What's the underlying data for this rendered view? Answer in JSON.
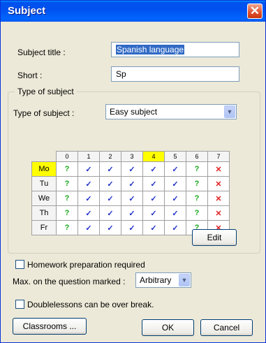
{
  "window": {
    "title": "Subject",
    "close_glyph": "✕"
  },
  "form": {
    "subject_title_label": "Subject title :",
    "subject_title_value": "Spanish language",
    "short_label": "Short :",
    "short_value": "Sp"
  },
  "group": {
    "legend": "Type of subject",
    "type_label": "Type of subject :",
    "type_value": "Easy subject",
    "periods": [
      "0",
      "1",
      "2",
      "3",
      "4",
      "5",
      "6",
      "7"
    ],
    "highlight_period": "4",
    "days": [
      {
        "name": "Mo",
        "cells": [
          "?",
          "✓",
          "✓",
          "✓",
          "✓",
          "✓",
          "?",
          "✕"
        ]
      },
      {
        "name": "Tu",
        "cells": [
          "?",
          "✓",
          "✓",
          "✓",
          "✓",
          "✓",
          "?",
          "✕"
        ]
      },
      {
        "name": "We",
        "cells": [
          "?",
          "✓",
          "✓",
          "✓",
          "✓",
          "✓",
          "?",
          "✕"
        ]
      },
      {
        "name": "Th",
        "cells": [
          "?",
          "✓",
          "✓",
          "✓",
          "✓",
          "✓",
          "?",
          "✕"
        ]
      },
      {
        "name": "Fr",
        "cells": [
          "?",
          "✓",
          "✓",
          "✓",
          "✓",
          "✓",
          "?",
          "✕"
        ]
      }
    ],
    "highlight_day": "Mo",
    "edit_button": "Edit"
  },
  "options": {
    "homework_label": "Homework preparation required",
    "homework_checked": false,
    "max_label": "Max. on the question marked :",
    "max_value": "Arbitrary",
    "double_label": "Doublelessons can be over break.",
    "double_checked": false
  },
  "buttons": {
    "classrooms": "Classrooms ...",
    "ok": "OK",
    "cancel": "Cancel"
  },
  "colors": {
    "titlebar": "#0053EE",
    "highlight": "#FFFF00",
    "available": "#18A818",
    "allowed": "#2030C8",
    "forbidden": "#E02020"
  },
  "icons": {
    "close": "close-icon",
    "dropdown": "chevron-down-icon"
  }
}
